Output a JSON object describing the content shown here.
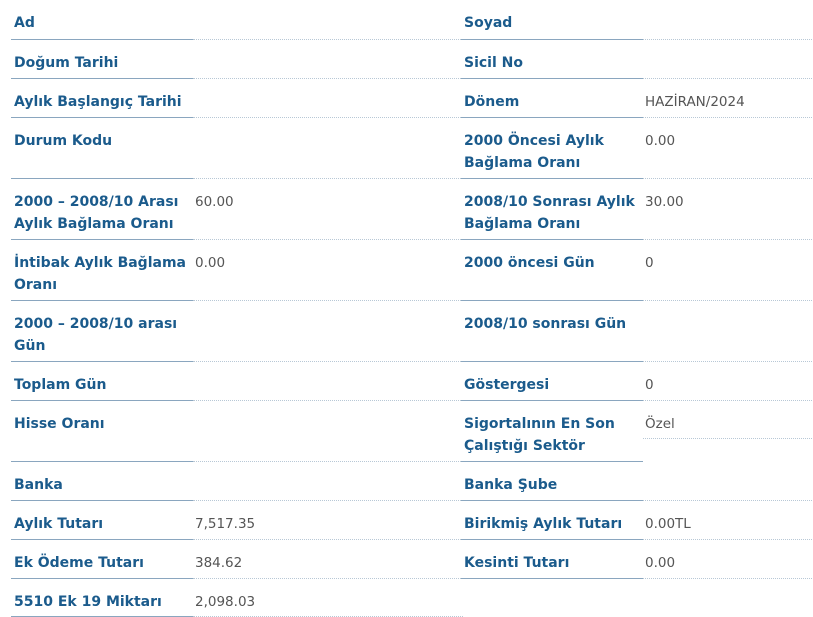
{
  "rows": [
    {
      "left": {
        "label": "Ad",
        "value": ""
      },
      "right": {
        "label": "Soyad",
        "value": ""
      }
    },
    {
      "left": {
        "label": "Doğum Tarihi",
        "value": ""
      },
      "right": {
        "label": "Sicil No",
        "value": ""
      }
    },
    {
      "left": {
        "label": "Aylık Başlangıç Tarihi",
        "value": ""
      },
      "right": {
        "label": "Dönem",
        "value": "HAZİRAN/2024"
      }
    },
    {
      "left": {
        "label": "Durum Kodu",
        "value": ""
      },
      "right": {
        "label": "2000 Öncesi Aylık Bağlama Oranı",
        "value": "0.00"
      }
    },
    {
      "left": {
        "label": "2000 – 2008/10 Arası Aylık Bağlama Oranı",
        "value": "60.00"
      },
      "right": {
        "label": "2008/10 Sonrası Aylık Bağlama Oranı",
        "value": "30.00"
      }
    },
    {
      "left": {
        "label": "İntibak Aylık Bağlama Oranı",
        "value": "0.00"
      },
      "right": {
        "label": "2000 öncesi Gün",
        "value": "0"
      }
    },
    {
      "left": {
        "label": "2000 – 2008/10 arası Gün",
        "value": ""
      },
      "right": {
        "label": "2008/10 sonrası Gün",
        "value": ""
      }
    },
    {
      "left": {
        "label": "Toplam Gün",
        "value": ""
      },
      "right": {
        "label": "Göstergesi",
        "value": "0"
      }
    },
    {
      "left": {
        "label": "Hisse Oranı",
        "value": ""
      },
      "right": {
        "label": "Sigortalının En Son Çalıştığı Sektör",
        "value": "Özel"
      }
    },
    {
      "left": {
        "label": "Banka",
        "value": ""
      },
      "right": {
        "label": "Banka Şube",
        "value": ""
      }
    },
    {
      "left": {
        "label": "Aylık Tutarı",
        "value": "7,517.35"
      },
      "right": {
        "label": "Birikmiş Aylık Tutarı",
        "value": "0.00TL"
      }
    },
    {
      "left": {
        "label": "Ek Ödeme Tutarı",
        "value": "384.62"
      },
      "right": {
        "label": "Kesinti Tutarı",
        "value": "0.00"
      }
    },
    {
      "left": {
        "label": "5510 Ek 19 Miktarı",
        "value": "2,098.03"
      }
    }
  ]
}
